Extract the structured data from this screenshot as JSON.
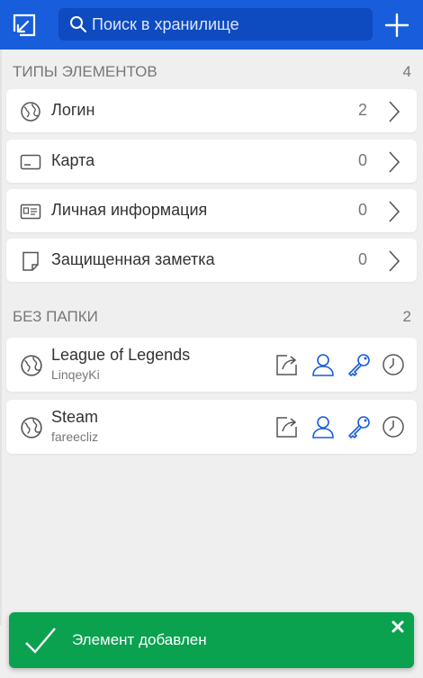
{
  "header": {
    "search_placeholder": "Поиск в хранилище"
  },
  "types_section": {
    "title": "ТИПЫ ЭЛЕМЕНТОВ",
    "count": "4",
    "items": [
      {
        "label": "Логин",
        "count": "2",
        "icon": "globe-icon"
      },
      {
        "label": "Карта",
        "count": "0",
        "icon": "credit-card-icon"
      },
      {
        "label": "Личная информация",
        "count": "0",
        "icon": "id-card-icon"
      },
      {
        "label": "Защищенная заметка",
        "count": "0",
        "icon": "note-icon"
      }
    ]
  },
  "nofolder_section": {
    "title": "БЕЗ ПАПКИ",
    "count": "2",
    "items": [
      {
        "name": "League of Legends",
        "username": "LinqeyKi",
        "icon": "globe-icon"
      },
      {
        "name": "Steam",
        "username": "fareecliz",
        "icon": "globe-icon"
      }
    ]
  },
  "toast": {
    "message": "Элемент добавлен"
  },
  "colors": {
    "header_bg": "#175ddc",
    "accent_blue": "#175ddc",
    "toast_bg": "#0aa14f",
    "page_bg": "#efefef"
  }
}
